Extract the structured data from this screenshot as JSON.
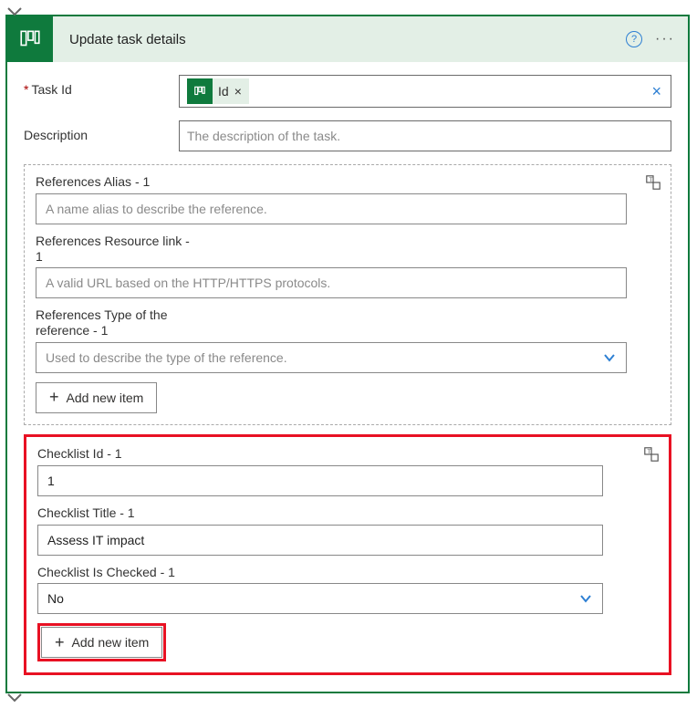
{
  "header": {
    "title": "Update task details"
  },
  "fields": {
    "taskId": {
      "label": "Task Id",
      "tokenLabel": "Id"
    },
    "description": {
      "label": "Description",
      "placeholder": "The description of the task."
    }
  },
  "refGroup": {
    "alias": {
      "label": "References Alias - 1",
      "placeholder": "A name alias to describe the reference."
    },
    "resource": {
      "label": "References Resource link - 1",
      "placeholder": "A valid URL based on the HTTP/HTTPS protocols."
    },
    "type": {
      "label": "References Type of the reference - 1",
      "placeholder": "Used to describe the type of the reference."
    },
    "addButton": "Add new item"
  },
  "checklistGroup": {
    "id": {
      "label": "Checklist Id - 1",
      "value": "1"
    },
    "title": {
      "label": "Checklist Title - 1",
      "value": "Assess IT impact"
    },
    "checked": {
      "label": "Checklist Is Checked - 1",
      "value": "No"
    },
    "addButton": "Add new item"
  }
}
